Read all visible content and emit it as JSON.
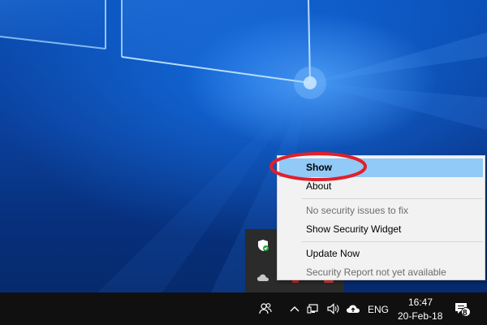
{
  "context_menu": {
    "items": [
      {
        "label": "Show",
        "state": "selected"
      },
      {
        "label": "About",
        "state": "enabled"
      },
      {
        "label": "No security issues to fix",
        "state": "disabled"
      },
      {
        "label": "Show Security Widget",
        "state": "enabled"
      },
      {
        "label": "Update Now",
        "state": "enabled"
      },
      {
        "label": "Security Report not yet available",
        "state": "disabled"
      }
    ]
  },
  "taskbar": {
    "language": "ENG",
    "time": "16:47",
    "date": "20-Feb-18",
    "notification_count": "8"
  },
  "colors": {
    "menu_highlight": "#91c9f7",
    "annotation_ellipse": "#e0202a",
    "taskbar_bg": "#101010"
  },
  "icons": [
    "shield-check-icon",
    "cloud-icon",
    "people-icon",
    "chevron-up-icon",
    "network-icon",
    "volume-icon",
    "onedrive-icon",
    "action-center-icon"
  ]
}
